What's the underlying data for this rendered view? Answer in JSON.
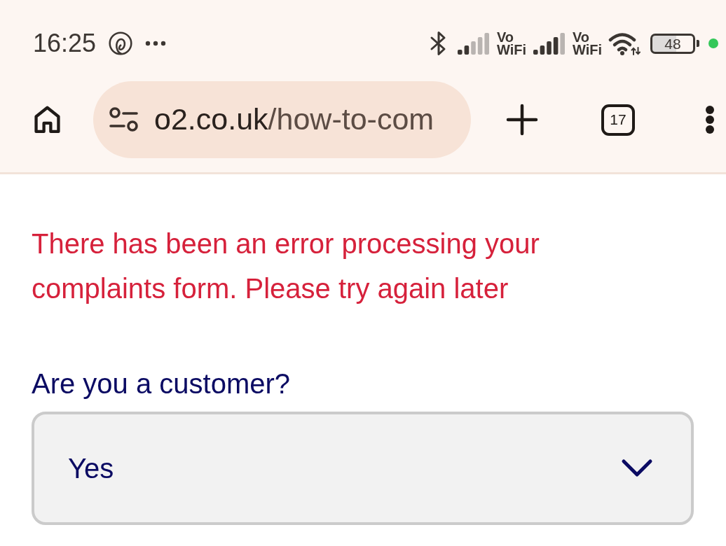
{
  "status_bar": {
    "time": "16:25",
    "network_labels": [
      {
        "line_1": "Vo",
        "line_2": "WiFi"
      },
      {
        "line_1": "Vo",
        "line_2": "WiFi"
      }
    ],
    "battery": "48"
  },
  "browser_toolbar": {
    "url": {
      "domain": "o2.co.uk",
      "path": "/how-to-com"
    },
    "tab_count": "17"
  },
  "page": {
    "error_message": "There has been an error processing your complaints form. Please try again later",
    "customer_field": {
      "label": "Are you a customer?",
      "value": "Yes"
    }
  }
}
